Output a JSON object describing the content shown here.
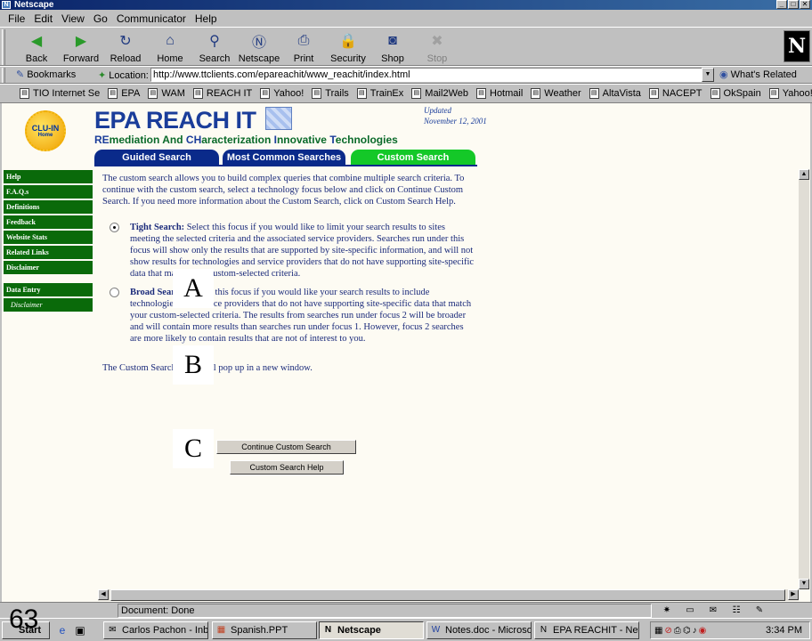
{
  "window": {
    "title": "Netscape"
  },
  "menu": [
    "File",
    "Edit",
    "View",
    "Go",
    "Communicator",
    "Help"
  ],
  "toolbar": [
    {
      "label": "Back",
      "icon": "back-arrow-icon",
      "glyph": "◀",
      "color": "#2a9a2a",
      "enabled": true
    },
    {
      "label": "Forward",
      "icon": "forward-arrow-icon",
      "glyph": "▶",
      "color": "#2a9a2a",
      "enabled": true
    },
    {
      "label": "Reload",
      "icon": "reload-icon",
      "glyph": "↻",
      "color": "#203a80",
      "enabled": true
    },
    {
      "label": "Home",
      "icon": "home-icon",
      "glyph": "⌂",
      "color": "#203a80",
      "enabled": true
    },
    {
      "label": "Search",
      "icon": "search-icon",
      "glyph": "⚲",
      "color": "#203a80",
      "enabled": true
    },
    {
      "label": "Netscape",
      "icon": "netscape-icon",
      "glyph": "Ⓝ",
      "color": "#203a80",
      "enabled": true
    },
    {
      "label": "Print",
      "icon": "print-icon",
      "glyph": "⎙",
      "color": "#203a80",
      "enabled": true
    },
    {
      "label": "Security",
      "icon": "lock-icon",
      "glyph": "🔒",
      "color": "#b08020",
      "enabled": true
    },
    {
      "label": "Shop",
      "icon": "shop-icon",
      "glyph": "◙",
      "color": "#203a80",
      "enabled": true
    },
    {
      "label": "Stop",
      "icon": "stop-icon",
      "glyph": "✖",
      "color": "#a0a0a0",
      "enabled": false
    }
  ],
  "location": {
    "bookmarks_label": "Bookmarks",
    "location_label": "Location:",
    "url": "http://www.ttclients.com/epareachit/www_reachit/index.html",
    "related_label": "What's Related"
  },
  "personal_toolbar": [
    "TIO Internet Se",
    "EPA",
    "WAM",
    "REACH IT",
    "Yahoo!",
    "Trails",
    "TrainEx",
    "Mail2Web",
    "Hotmail",
    "Weather",
    "AltaVista",
    "NACEPT",
    "OkSpain",
    "Yahoo!"
  ],
  "page": {
    "logo_text": "CLU-IN",
    "logo_sub": "Home",
    "title": "EPA REACH IT",
    "subtitle": {
      "w1a": "RE",
      "w1b": "mediation ",
      "w2": "And ",
      "w3a": "CH",
      "w3b": "aracterization ",
      "w4a": "I",
      "w4b": "nnovative ",
      "w5a": "T",
      "w5b": "echnologies"
    },
    "updated_label": "Updated",
    "updated_date": "November 12, 2001",
    "tabs": {
      "guided": "Guided Search",
      "common": "Most Common Searches",
      "custom": "Custom Search"
    },
    "sidebar": {
      "items": [
        "Help",
        "F.A.Q.s",
        "Definitions",
        "Feedback",
        "Website Stats",
        "Related Links",
        "Disclaimer"
      ],
      "data_entry": "Data Entry",
      "data_disclaimer": "Disclaimer"
    },
    "intro": "The custom search allows you to build complex queries that combine multiple search criteria. To continue with the custom search, select a technology focus below and click on Continue Custom Search. If you need more information about the Custom Search, click on Custom Search Help.",
    "tight": {
      "label": "Tight Search:",
      "text": "Select this focus if you would like to limit your search results to sites meeting the selected criteria and the associated service providers. Searches run under this focus will show only the results that are supported by site-specific information, and will not show results for technologies and service providers that do not have supporting site-specific data that match your custom-selected criteria.",
      "selected": true
    },
    "broad": {
      "label": "Broad Search:",
      "text": "Select this focus if you would like your search results to include technologies and service providers that do not have supporting site-specific data that match your custom-selected criteria. The results from searches run under focus 2 will be broader and will contain more results than searches run under focus 1. However, focus 2 searches are more likely to contain results that are not of interest to you.",
      "selected": false
    },
    "popup_note": "The Custom Search menu will pop up in a new window.",
    "continue_button": "Continue Custom Search",
    "help_button": "Custom Search Help",
    "markers": {
      "a": "A",
      "b": "B",
      "c": "C"
    }
  },
  "status": {
    "text": "Document: Done"
  },
  "taskbar": {
    "start": "Start",
    "tasks": [
      {
        "label": "Carlos Pachon - Inbo...",
        "active": false
      },
      {
        "label": "Spanish.PPT",
        "active": false
      },
      {
        "label": "Netscape",
        "active": true
      },
      {
        "label": "Notes.doc - Microsof...",
        "active": false
      },
      {
        "label": "EPA REACHIT - Net...",
        "active": false
      }
    ],
    "clock": "3:34 PM"
  },
  "slide_number": "63",
  "colors": {
    "accent_blue": "#1a3d9a",
    "green": "#0a6a0a",
    "tab_active": "#14c828"
  }
}
